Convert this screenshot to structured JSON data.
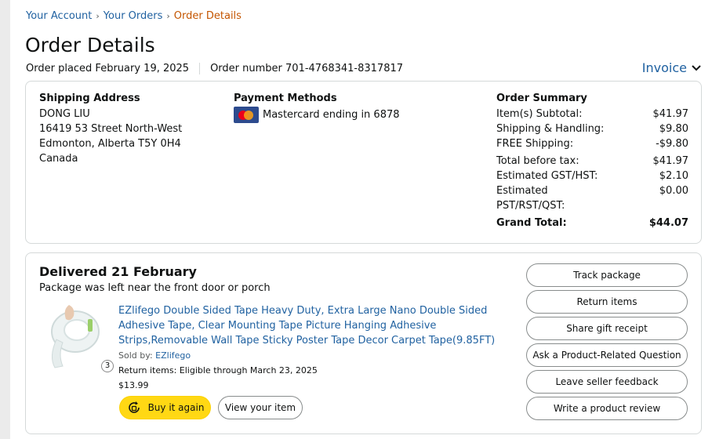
{
  "breadcrumb": {
    "items": [
      "Your Account",
      "Your Orders"
    ],
    "current": "Order Details",
    "separator": "›"
  },
  "page": {
    "title": "Order Details",
    "order_placed": "Order placed February 19, 2025",
    "order_number": "Order number 701-4768341-8317817",
    "invoice_label": "Invoice"
  },
  "shipping": {
    "heading": "Shipping Address",
    "name": "DONG LIU",
    "street": "16419 53 Street North-West",
    "city": "Edmonton, Alberta T5Y 0H4",
    "country": "Canada"
  },
  "payment": {
    "heading": "Payment Methods",
    "card": "Mastercard ending in 6878",
    "icon": "mastercard-icon"
  },
  "summary": {
    "heading": "Order Summary",
    "rows": [
      {
        "label": "Item(s) Subtotal:",
        "value": "$41.97"
      },
      {
        "label": "Shipping & Handling:",
        "value": "$9.80"
      },
      {
        "label": "FREE Shipping:",
        "value": "-$9.80"
      },
      {
        "label": "Total before tax:",
        "value": "$41.97"
      },
      {
        "label": "Estimated GST/HST:",
        "value": "$2.10"
      },
      {
        "label": "Estimated",
        "value": "$0.00"
      },
      {
        "label": "PST/RST/QST:",
        "value": ""
      }
    ],
    "grand_label": "Grand Total:",
    "grand_value": "$44.07"
  },
  "delivery": {
    "title": "Delivered 21 February",
    "subtitle": "Package was left near the front door or porch",
    "product": {
      "title": "EZlifego Double Sided Tape Heavy Duty, Extra Large Nano Double Sided Adhesive Tape, Clear Mounting Tape Picture Hanging Adhesive Strips,Removable Wall Tape Sticky Poster Tape Decor Carpet Tape(9.85FT)",
      "sold_by_label": "Sold by:",
      "seller": "EZlifego",
      "return_text": "Return items: Eligible through March 23, 2025",
      "price": "$13.99",
      "quantity": "3"
    },
    "buy_again": "Buy it again",
    "view_item": "View your item",
    "actions": [
      "Track package",
      "Return items",
      "Share gift receipt",
      "Ask a Product-Related Question",
      "Leave seller feedback",
      "Write a product review"
    ]
  },
  "colors": {
    "link": "#2162a1",
    "current_crumb": "#c45500",
    "buy_button": "#ffd814",
    "border": "#d5d9d9"
  }
}
